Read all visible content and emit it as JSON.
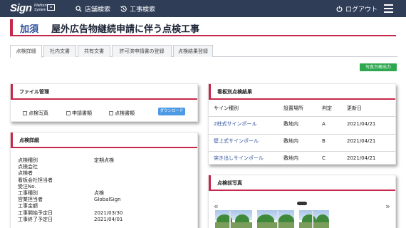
{
  "header": {
    "logo": {
      "main": "Sign",
      "sub_top": "Platform",
      "sub_bottom": "System"
    },
    "nav": [
      {
        "label": "店舗検索",
        "icon": "search-icon"
      },
      {
        "label": "工事検索",
        "icon": "history-icon"
      }
    ],
    "logout_label": "ログアウト",
    "menu_icon": "hamburger-menu-icon"
  },
  "page": {
    "badge": "加須",
    "title": "屋外広告物継続申請に伴う点検工事"
  },
  "tabs": [
    "点検詳細",
    "社内文書",
    "共有文書",
    "許可済申請書の登録",
    "点検結果登録"
  ],
  "export_button": "写真台帳出力",
  "file_management": {
    "title": "ファイル管理",
    "checkboxes": [
      "点検写真",
      "申請書類",
      "点検書類"
    ],
    "download_label": "ダウンロード"
  },
  "inspection_details": {
    "title": "点検詳細",
    "rows": [
      {
        "label": "点検種別",
        "value": "定期点検"
      },
      {
        "label": "点検会社",
        "value": ""
      },
      {
        "label": "点検者",
        "value": ""
      },
      {
        "label": "看板会社担当者",
        "value": ""
      },
      {
        "label": "受注No.",
        "value": ""
      },
      {
        "label": "工事種別",
        "value": "点検"
      },
      {
        "label": "営業担当者",
        "value": "GlobalSign"
      },
      {
        "label": "工事金額",
        "value": ""
      },
      {
        "label": "工事開始予定日",
        "value": "2021/03/30"
      },
      {
        "label": "工事終了予定日",
        "value": "2021/04/01"
      }
    ]
  },
  "sign_results": {
    "title": "看板別点検結果",
    "columns": [
      "サイン種別",
      "設置場所",
      "判定",
      "更新日"
    ],
    "rows": [
      {
        "sign": "2柱式サインポール",
        "place": "敷地内",
        "grade": "A",
        "date": "2021/04/21"
      },
      {
        "sign": "壁上式サインポール",
        "place": "敷地内",
        "grade": "B",
        "date": "2021/04/21"
      },
      {
        "sign": "突き出しサインポール",
        "place": "敷地内",
        "grade": "C",
        "date": "2021/04/21"
      }
    ]
  },
  "photos": {
    "title": "点検前写真",
    "prev": "«",
    "next": "»"
  },
  "colors": {
    "accent": "#c5284b",
    "topbar": "#2f3d57",
    "link": "#2e4f9c",
    "export": "#2ea84f",
    "download": "#4d9ae4"
  }
}
